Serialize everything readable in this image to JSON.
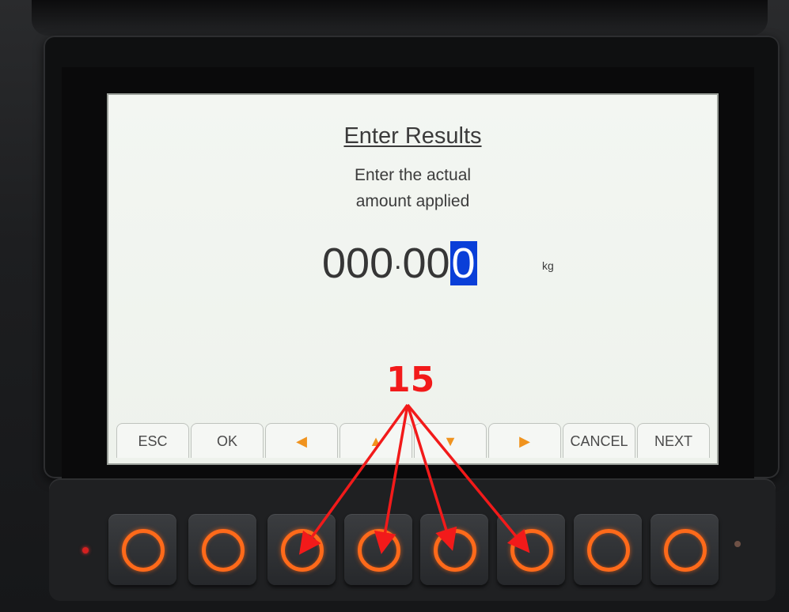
{
  "screen": {
    "title": "Enter Results",
    "instruction_line1": "Enter the actual",
    "instruction_line2": "amount applied",
    "value_main": "000",
    "value_decimal_sep": "·",
    "value_fraction": "00",
    "value_cursor_digit": "0",
    "unit": "kg"
  },
  "softkeys": [
    {
      "label": "ESC"
    },
    {
      "label": "OK"
    },
    {
      "label": "◀"
    },
    {
      "label": "▲"
    },
    {
      "label": "▼"
    },
    {
      "label": "▶"
    },
    {
      "label": "CANCEL"
    },
    {
      "label": "NEXT"
    }
  ],
  "annotation": {
    "callout_number": "15",
    "color": "#f21a1a"
  },
  "colors": {
    "accent_arrow": "#f0931e",
    "cursor_highlight": "#0a3fd8",
    "key_ring": "#ff6a1a"
  }
}
